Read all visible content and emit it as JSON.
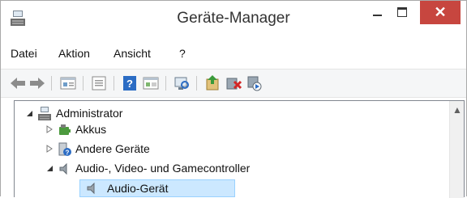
{
  "window": {
    "title": "Geräte-Manager",
    "close_glyph": "✕",
    "accent_close": "#c7463f"
  },
  "menu": [
    "Datei",
    "Aktion",
    "Ansicht",
    "?"
  ],
  "toolbar_icons": [
    "back-icon",
    "forward-icon",
    "properties-icon",
    "list-icon",
    "help-icon",
    "view-icon",
    "scan-icon",
    "update-driver-icon",
    "uninstall-icon",
    "enable-icon"
  ],
  "tree": {
    "root": "Administrator",
    "items": [
      {
        "label": "Akkus",
        "icon": "battery-icon",
        "expanded": false
      },
      {
        "label": "Andere Geräte",
        "icon": "unknown-device-icon",
        "expanded": false
      },
      {
        "label": "Audio-, Video- und Gamecontroller",
        "icon": "speaker-icon",
        "expanded": true
      }
    ],
    "child": {
      "label": "Audio-Gerät",
      "icon": "speaker-icon",
      "selected": true
    }
  }
}
